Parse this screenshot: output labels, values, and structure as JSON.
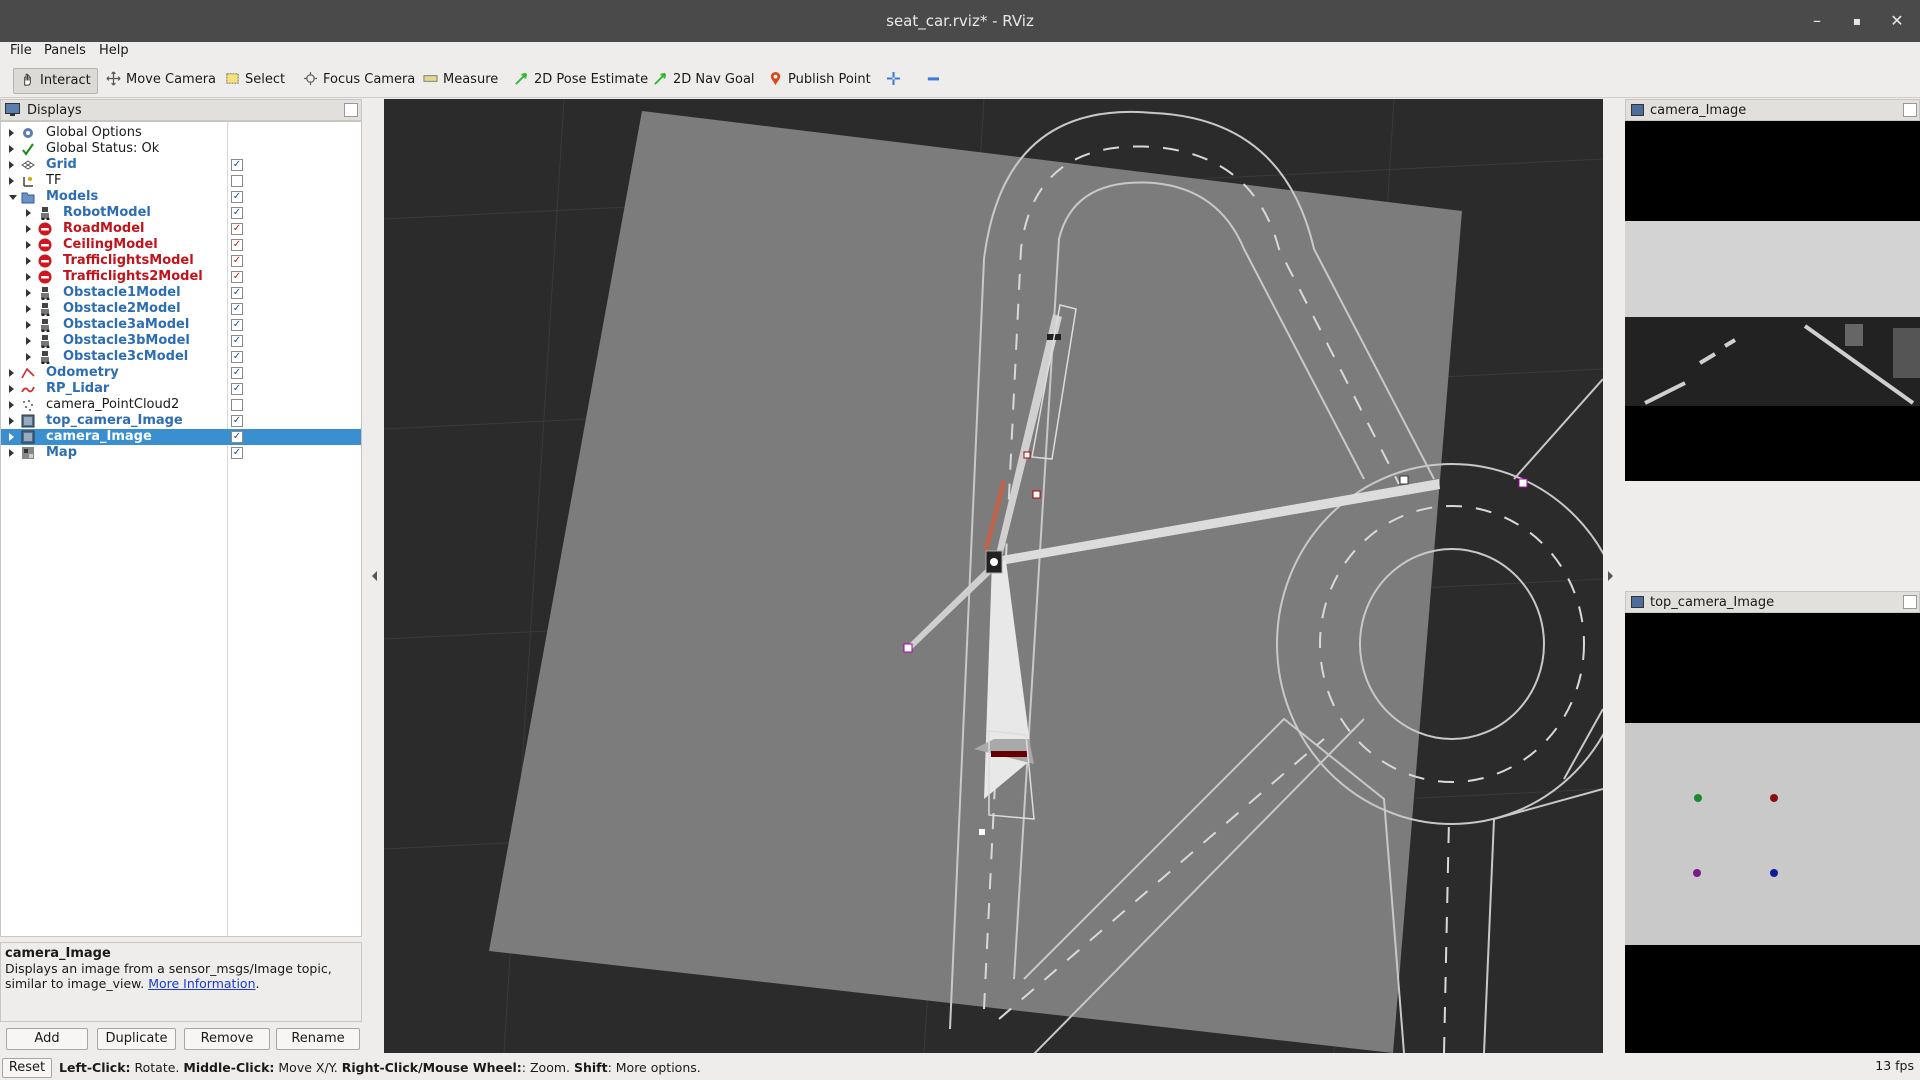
{
  "window": {
    "title": "seat_car.rviz* - RViz",
    "minimize_glyph": "–",
    "maximize_glyph": "▪",
    "close_glyph": "✕"
  },
  "menubar": [
    "File",
    "Panels",
    "Help"
  ],
  "toolbar": {
    "tools": [
      {
        "label": "Interact",
        "icon": "interact-hand-icon",
        "active": true
      },
      {
        "label": "Move Camera",
        "icon": "move-camera-icon",
        "active": false
      },
      {
        "label": "Select",
        "icon": "select-box-icon",
        "active": false
      },
      {
        "label": "Focus Camera",
        "icon": "focus-camera-icon",
        "active": false
      },
      {
        "label": "Measure",
        "icon": "ruler-icon",
        "active": false
      },
      {
        "label": "2D Pose Estimate",
        "icon": "pose-arrow-icon",
        "active": false
      },
      {
        "label": "2D Nav Goal",
        "icon": "nav-goal-arrow-icon",
        "active": false
      },
      {
        "label": "Publish Point",
        "icon": "map-pin-icon",
        "active": false
      }
    ],
    "add_tool_icon": "plus-icon",
    "remove_tool_icon": "minus-icon"
  },
  "displays": {
    "title": "Displays",
    "items": [
      {
        "label": "Global Options",
        "style": "plain",
        "indent": 0,
        "checked": null,
        "icon": "gear-icon",
        "expanded": false
      },
      {
        "label": "Global Status: Ok",
        "style": "plain",
        "indent": 0,
        "checked": null,
        "icon": "checkmark-icon",
        "expanded": false
      },
      {
        "label": "Grid",
        "style": "blue",
        "indent": 0,
        "checked": true,
        "icon": "grid-icon",
        "expanded": false
      },
      {
        "label": "TF",
        "style": "plain",
        "indent": 0,
        "checked": false,
        "icon": "tf-axes-icon",
        "expanded": false
      },
      {
        "label": "Models",
        "style": "blue",
        "indent": 0,
        "checked": true,
        "icon": "folder-icon",
        "expanded": true
      },
      {
        "label": "RobotModel",
        "style": "blue",
        "indent": 1,
        "checked": true,
        "icon": "robot-icon",
        "expanded": false
      },
      {
        "label": "RoadModel",
        "style": "red",
        "indent": 1,
        "checked": true,
        "icon": "error-icon",
        "expanded": false
      },
      {
        "label": "CeilingModel",
        "style": "red",
        "indent": 1,
        "checked": true,
        "icon": "error-icon",
        "expanded": false
      },
      {
        "label": "TrafficlightsModel",
        "style": "red",
        "indent": 1,
        "checked": true,
        "icon": "error-icon",
        "expanded": false
      },
      {
        "label": "Trafficlights2Model",
        "style": "red",
        "indent": 1,
        "checked": true,
        "icon": "error-icon",
        "expanded": false
      },
      {
        "label": "Obstacle1Model",
        "style": "blue",
        "indent": 1,
        "checked": true,
        "icon": "robot-icon",
        "expanded": false
      },
      {
        "label": "Obstacle2Model",
        "style": "blue",
        "indent": 1,
        "checked": true,
        "icon": "robot-icon",
        "expanded": false
      },
      {
        "label": "Obstacle3aModel",
        "style": "blue",
        "indent": 1,
        "checked": true,
        "icon": "robot-icon",
        "expanded": false
      },
      {
        "label": "Obstacle3bModel",
        "style": "blue",
        "indent": 1,
        "checked": true,
        "icon": "robot-icon",
        "expanded": false
      },
      {
        "label": "Obstacle3cModel",
        "style": "blue",
        "indent": 1,
        "checked": true,
        "icon": "robot-icon",
        "expanded": false
      },
      {
        "label": "Odometry",
        "style": "blue",
        "indent": 0,
        "checked": true,
        "icon": "odometry-icon",
        "expanded": false
      },
      {
        "label": "RP_Lidar",
        "style": "blue",
        "indent": 0,
        "checked": true,
        "icon": "laser-scan-icon",
        "expanded": false
      },
      {
        "label": "camera_PointCloud2",
        "style": "plain",
        "indent": 0,
        "checked": false,
        "icon": "pointcloud-icon",
        "expanded": false
      },
      {
        "label": "top_camera_Image",
        "style": "blue",
        "indent": 0,
        "checked": true,
        "icon": "image-icon",
        "expanded": false
      },
      {
        "label": "camera_Image",
        "style": "blue",
        "indent": 0,
        "checked": true,
        "icon": "image-icon",
        "expanded": false,
        "selected": true
      },
      {
        "label": "Map",
        "style": "blue",
        "indent": 0,
        "checked": true,
        "icon": "map-icon",
        "expanded": false
      }
    ]
  },
  "description": {
    "title": "camera_Image",
    "body": "Displays an image from a sensor_msgs/Image topic, similar to image_view.",
    "link": "More Information",
    "link_suffix": "."
  },
  "panel_buttons": [
    "Add",
    "Duplicate",
    "Remove",
    "Rename"
  ],
  "image_panels": {
    "camera": {
      "title": "camera_Image"
    },
    "top_camera": {
      "title": "top_camera_Image"
    }
  },
  "top_camera_dots": [
    {
      "color": "#1b8a2a"
    },
    {
      "color": "#8a1010"
    },
    {
      "color": "#7a1a8a"
    },
    {
      "color": "#101a9a"
    }
  ],
  "statusbar": {
    "reset": "Reset",
    "hint_parts": [
      {
        "text": "Left-Click:",
        "bold": true
      },
      {
        "text": " Rotate. ",
        "bold": false
      },
      {
        "text": "Middle-Click:",
        "bold": true
      },
      {
        "text": " Move X/Y. ",
        "bold": false
      },
      {
        "text": "Right-Click/Mouse Wheel:",
        "bold": true
      },
      {
        "text": ": Zoom. ",
        "bold": false
      },
      {
        "text": "Shift",
        "bold": true
      },
      {
        "text": ": More options.",
        "bold": false
      }
    ],
    "fps": "13 fps"
  },
  "colors": {
    "selection": "#3a8fd1",
    "display_ok": "#2d6db3",
    "display_error": "#c0141c",
    "viewport_bg": "#2b2b2b",
    "map_plane": "#7a7a7a"
  }
}
